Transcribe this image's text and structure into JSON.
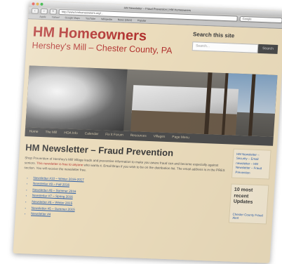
{
  "browser": {
    "window_title": "HM Newsletter – Fraud Prevention | HM Homeowners",
    "url": "http://www.hmhomeowners.org/...",
    "search_placeholder": "Google",
    "bookmarks": [
      "Apple",
      "Yahoo!",
      "Google Maps",
      "YouTube",
      "Wikipedia",
      "News (2524)",
      "Popular"
    ]
  },
  "site": {
    "title": "HM Homeowners",
    "subtitle": "Hershey's Mill – Chester County, PA",
    "search_label": "Search this site",
    "search_placeholder": "Search...",
    "search_button": "Search"
  },
  "nav": [
    "Home",
    "The Mill",
    "HOA Info",
    "Calendar",
    "Fix It Forum",
    "Resources",
    "Villages",
    "Page Menu"
  ],
  "main": {
    "title": "HM Newsletter – Fraud Prevention",
    "intro": "Shop Prevention of Hershey's Mill Village leads and preventive information to make you aware fraud can and become especially against seniors.",
    "intro_highlight": "This newsletter is free to anyone",
    "intro_rest": "who wants it. Email Brian if you wish to be on the distribution list. The email address is in the PRES section. You will receive the newsletter free.",
    "newsletters": [
      "Newsletter #10 – Winter 2016-2017",
      "Newsletter #9 – Fall 2016",
      "Newsletter #8 – Summer 2016",
      "Newsletter #7 – Spring 2016",
      "Newsletter #6 – Winter 2015",
      "Newsletter #5 – Summer 2015",
      "Newsletter #4"
    ]
  },
  "sidebar": {
    "box1": "HM Newsletter – Security – Email newsletter – HM Newsletter – Fraud Prevention",
    "box2_title": "10 most recent Updates",
    "box2_item": "Chester County Fraud Alert"
  },
  "colors": {
    "accent": "#b0302d",
    "link": "#2a5ca8",
    "page_bg": "#ebdcbc",
    "nav_bg": "#4d4d4d"
  }
}
